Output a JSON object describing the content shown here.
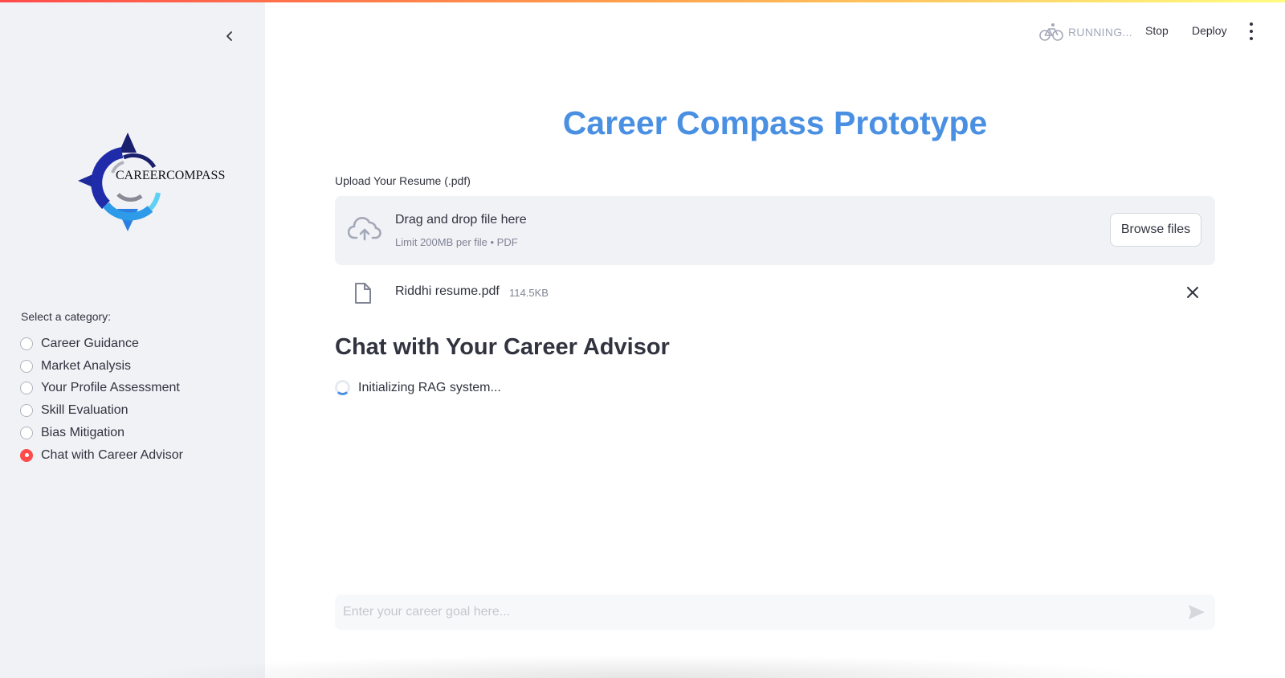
{
  "header": {
    "status_text": "RUNNING...",
    "stop_label": "Stop",
    "deploy_label": "Deploy"
  },
  "sidebar": {
    "logo_text": "CAREERCOMPASS",
    "category_label": "Select a category:",
    "options": [
      {
        "label": "Career Guidance",
        "selected": false
      },
      {
        "label": "Market Analysis",
        "selected": false
      },
      {
        "label": "Your Profile Assessment",
        "selected": false
      },
      {
        "label": "Skill Evaluation",
        "selected": false
      },
      {
        "label": "Bias Mitigation",
        "selected": false
      },
      {
        "label": "Chat with Career Advisor",
        "selected": true
      }
    ]
  },
  "main": {
    "title": "Career Compass Prototype",
    "upload_label": "Upload Your Resume (.pdf)",
    "dropzone_title": "Drag and drop file here",
    "dropzone_subtitle": "Limit 200MB per file • PDF",
    "browse_label": "Browse files",
    "file": {
      "name": "Riddhi resume.pdf",
      "size": "114.5KB"
    },
    "chat_heading": "Chat with Your Career Advisor",
    "spinner_text": "Initializing RAG system...",
    "chat_placeholder": "Enter your career goal here..."
  },
  "colors": {
    "accent_red": "#ff4b4b",
    "title_blue": "#4a90e2",
    "sidebar_bg": "#f0f2f6"
  }
}
